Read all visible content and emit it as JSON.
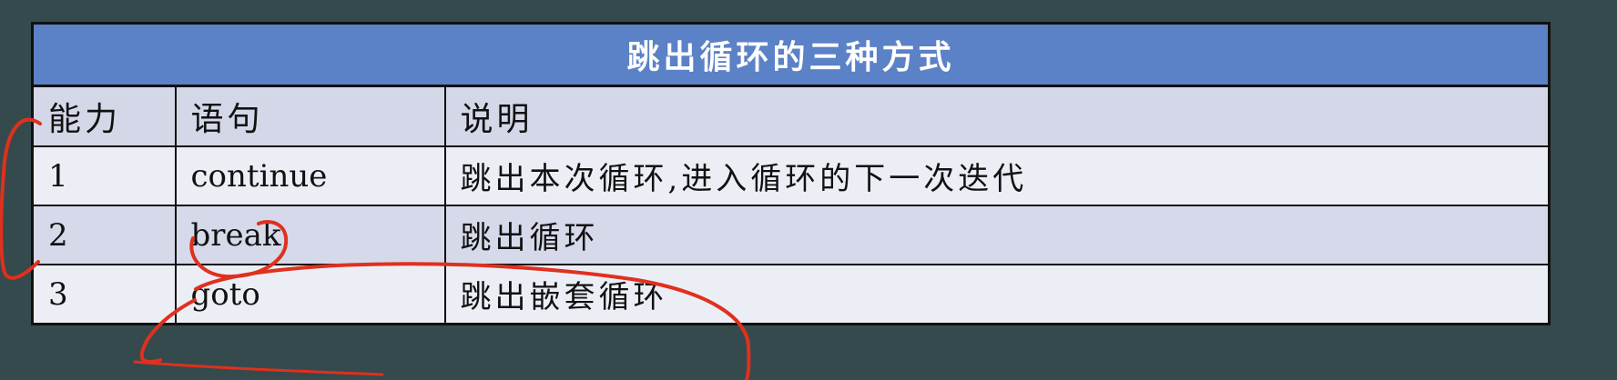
{
  "table": {
    "title": "跳出循环的三种方式",
    "headers": [
      "能力",
      "语句",
      "说明"
    ],
    "rows": [
      [
        "1",
        "continue",
        "跳出本次循环,进入循环的下一次迭代"
      ],
      [
        "2",
        "break",
        "跳出循环"
      ],
      [
        "3",
        "goto",
        "跳出嵌套循环"
      ]
    ]
  },
  "colors": {
    "background": "#354a4c",
    "title_bar": "#5b81c6",
    "header_row": "#d3d7e8",
    "row_light": "#eceef6",
    "row_dark": "#d5d9ea",
    "annotation_ink": "#e0301e"
  }
}
